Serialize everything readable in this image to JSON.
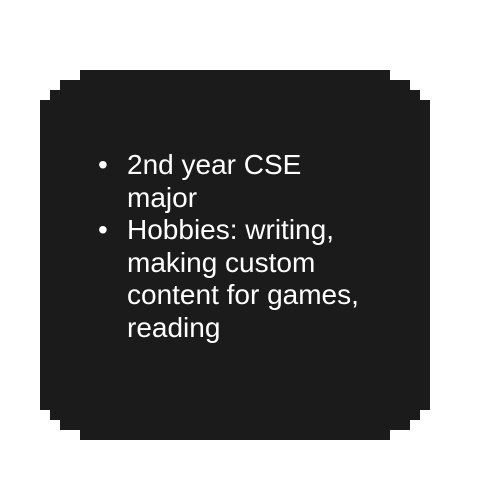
{
  "card": {
    "background_color": "#1b1b1b",
    "bullet_glyph": "•",
    "items": [
      {
        "lines": [
          "2nd year CSE",
          "major"
        ]
      },
      {
        "lines": [
          "Hobbies: writing,",
          "making custom",
          "content for games,",
          "reading"
        ]
      }
    ]
  }
}
